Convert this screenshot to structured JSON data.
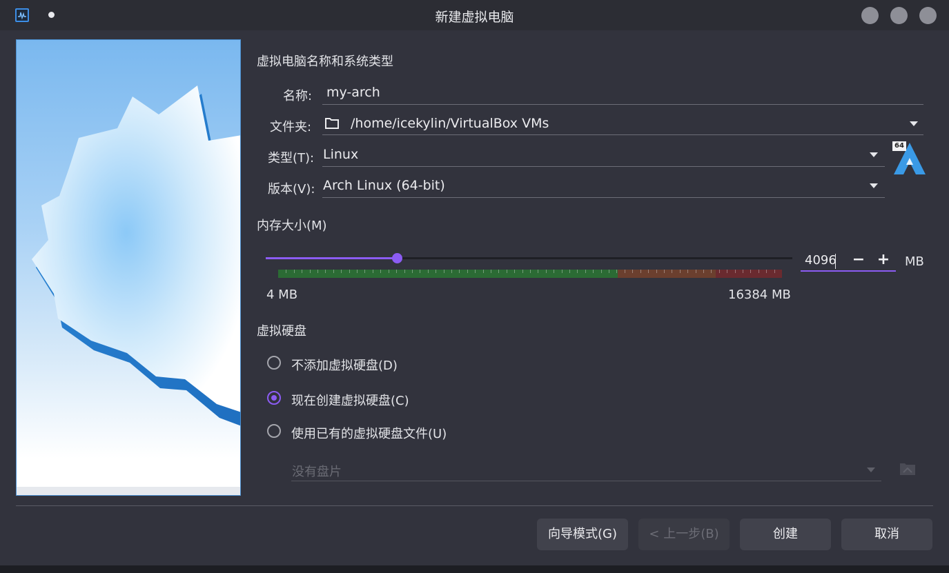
{
  "window": {
    "title": "新建虚拟电脑",
    "app_icon": "virtualbox-icon",
    "pin_icon": "pin-dot-icon"
  },
  "section_name_type": {
    "heading": "虚拟电脑名称和系统类型",
    "name_label": "名称:",
    "name_value": "my-arch",
    "folder_label": "文件夹:",
    "folder_value": "/home/icekylin/VirtualBox VMs",
    "type_label": "类型(T):",
    "type_value": "Linux",
    "version_label": "版本(V):",
    "version_value": "Arch Linux (64-bit)",
    "os_badge": "64"
  },
  "memory": {
    "heading": "内存大小(M)",
    "value": "4096",
    "unit": "MB",
    "min_label": "4 MB",
    "max_label": "16384 MB",
    "min": 4,
    "max": 16384,
    "current": 4096,
    "minus": "−",
    "plus": "+"
  },
  "disk": {
    "heading": "虚拟硬盘",
    "options": [
      {
        "label": "不添加虚拟硬盘(D)",
        "checked": false
      },
      {
        "label": "现在创建虚拟硬盘(C)",
        "checked": true
      },
      {
        "label": "使用已有的虚拟硬盘文件(U)",
        "checked": false
      }
    ],
    "existing_placeholder": "没有盘片"
  },
  "buttons": {
    "expert": "向导模式(G)",
    "back": "< 上一步(B)",
    "create": "创建",
    "cancel": "取消"
  },
  "colors": {
    "accent": "#8c5cf4",
    "background": "#32333d"
  }
}
